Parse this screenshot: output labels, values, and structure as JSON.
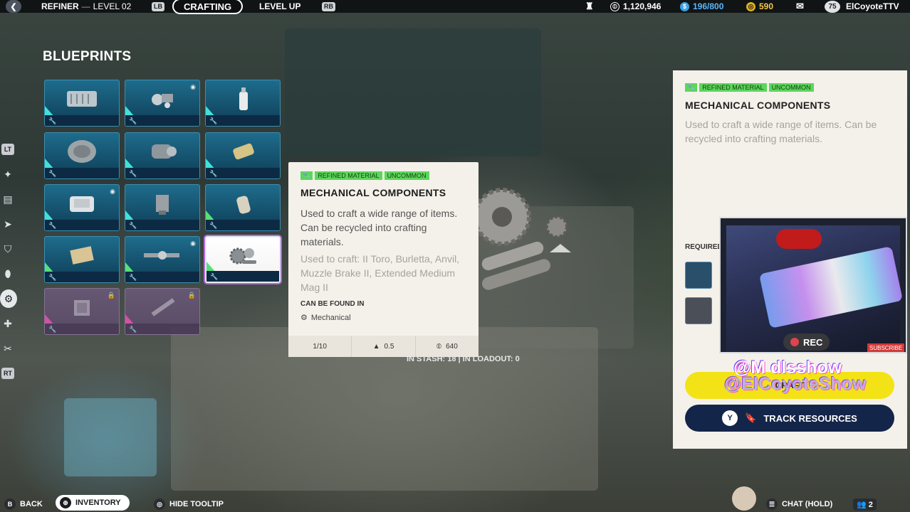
{
  "topbar": {
    "location": "REFINER",
    "level_sep": "—",
    "level": "LEVEL 02",
    "prev_key": "LB",
    "tab_active": "CRAFTING",
    "tab_other": "LEVEL UP",
    "next_key": "RB",
    "currency1": "1,120,946",
    "currency2": "196/800",
    "currency3": "590",
    "player_level": "75",
    "username": "ElCoyoteTTV"
  },
  "rail": {
    "top_key": "LT",
    "bottom_key": "RT"
  },
  "blueprints": {
    "title": "BLUEPRINTS"
  },
  "tooltip": {
    "tag_type": "REFINED MATERIAL",
    "tag_rarity": "UNCOMMON",
    "title": "MECHANICAL COMPONENTS",
    "description": "Used to craft a wide range of items. Can be recycled into crafting materials.",
    "used_to_craft": "Used to craft: II Toro, Burletta, Anvil, Muzzle Brake II, Extended Medium Mag II",
    "found_label": "CAN BE FOUND IN",
    "found_in": "Mechanical",
    "stack": "1/10",
    "weight": "0.5",
    "value": "640"
  },
  "stash": {
    "text": "IN STASH: 18  |  IN LOADOUT: 0"
  },
  "details": {
    "tag_type": "REFINED MATERIAL",
    "tag_rarity": "UNCOMMON",
    "title": "MECHANICAL COMPONENTS",
    "description": "Used to craft a wide range of items. Can be recycled into crafting materials.",
    "required_label": "REQUIRED",
    "craft_label": "CRAFT",
    "track_key": "Y",
    "track_label": "TRACK RESOURCES"
  },
  "overlay": {
    "rec_label": "REC",
    "subscribe": "SUBSCRIBE",
    "handle1": "@M dlsshow",
    "handle2": "@ElCoyoteShow"
  },
  "bottombar": {
    "back_key": "B",
    "back_label": "BACK",
    "inventory_key": "⊕",
    "inventory_label": "INVENTORY",
    "tooltip_label": "HIDE TOOLTIP",
    "chat_label": "CHAT (HOLD)",
    "party_count": "2"
  },
  "colors": {
    "tag_green": "#5cd65c",
    "craft_yellow": "#f3e316",
    "track_navy": "#14254a",
    "tile_blue": "#1e6c8c",
    "rarity_pink": "#e64fb3"
  }
}
